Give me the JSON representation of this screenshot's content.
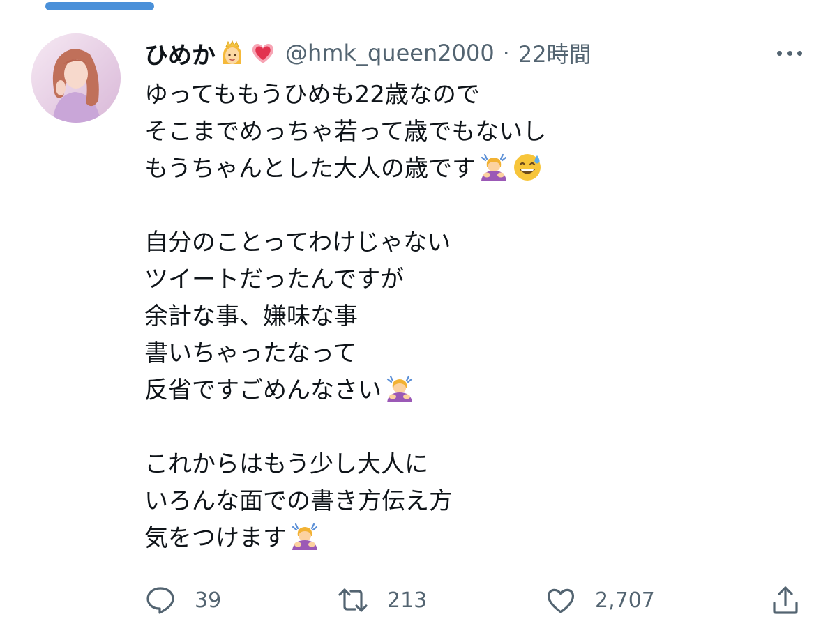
{
  "tweet": {
    "author": {
      "display_name": "ひめか",
      "name_badges": [
        "princess-emoji-icon",
        "heart-emoji-icon"
      ],
      "handle": "@hmk_queen2000",
      "separator": "·",
      "timestamp": "22時間"
    },
    "lines": [
      {
        "text": "ゆってももうひめも22歳なので",
        "emojis": []
      },
      {
        "text": "そこまでめっちゃ若って歳でもないし",
        "emojis": []
      },
      {
        "text": "もうちゃんとした大人の歳です",
        "emojis": [
          "bowing-woman-emoji-icon",
          "grinning-sweat-emoji-icon"
        ]
      },
      {
        "text": "",
        "emojis": []
      },
      {
        "text": "自分のことってわけじゃない",
        "emojis": []
      },
      {
        "text": "ツイートだったんですが",
        "emojis": []
      },
      {
        "text": "余計な事、嫌味な事",
        "emojis": []
      },
      {
        "text": "書いちゃったなって",
        "emojis": []
      },
      {
        "text": "反省ですごめんなさい",
        "emojis": [
          "bowing-woman-emoji-icon"
        ]
      },
      {
        "text": "",
        "emojis": []
      },
      {
        "text": "これからはもう少し大人に",
        "emojis": []
      },
      {
        "text": "いろんな面での書き方伝え方",
        "emojis": []
      },
      {
        "text": "気をつけます",
        "emojis": [
          "bowing-woman-emoji-icon"
        ]
      }
    ],
    "actions": {
      "reply": {
        "icon": "reply-icon",
        "count": "39"
      },
      "retweet": {
        "icon": "retweet-icon",
        "count": "213"
      },
      "like": {
        "icon": "heart-icon",
        "count": "2,707"
      },
      "share": {
        "icon": "share-icon"
      }
    }
  },
  "colors": {
    "text_primary": "#0f1419",
    "text_secondary": "#536471",
    "indicator": "#4a90d9"
  }
}
